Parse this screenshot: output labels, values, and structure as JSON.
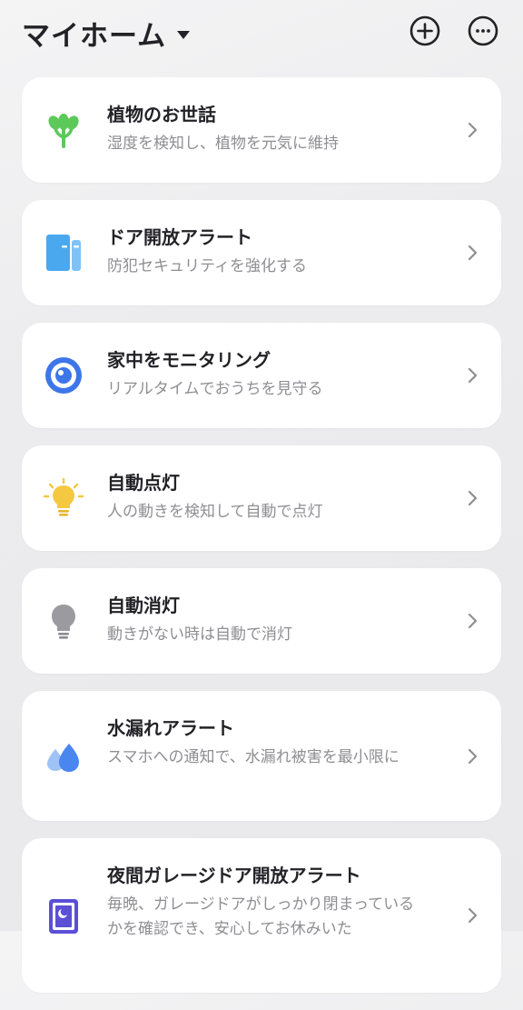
{
  "header": {
    "title": "マイホーム",
    "caret_icon": "caret-down-icon",
    "add_icon": "plus-circle-icon",
    "more_icon": "more-horizontal-icon"
  },
  "cards": [
    {
      "title": "植物のお世話",
      "description": "湿度を検知し、植物を元気に維持",
      "icon": "plant-icon",
      "icon_color": "#5cc95a"
    },
    {
      "title": "ドア開放アラート",
      "description": "防犯セキュリティを強化する",
      "icon": "door-sensor-icon",
      "icon_color": "#4aa8ef"
    },
    {
      "title": "家中をモニタリング",
      "description": "リアルタイムでおうちを見守る",
      "icon": "camera-eye-icon",
      "icon_color": "#3d76e8"
    },
    {
      "title": "自動点灯",
      "description": "人の動きを検知して自動で点灯",
      "icon": "lightbulb-on-icon",
      "icon_color": "#f5c842"
    },
    {
      "title": "自動消灯",
      "description": "動きがない時は自動で消灯",
      "icon": "lightbulb-off-icon",
      "icon_color": "#9a9aa0"
    },
    {
      "title": "水漏れアラート",
      "description": "スマホへの通知で、水漏れ被害を最小限に",
      "icon": "water-drops-icon",
      "icon_color": "#4a86f0"
    },
    {
      "title": "夜間ガレージドア開放アラート",
      "description": "毎晩、ガレージドアがしっかり閉まっているかを確認でき、安心してお休みいた",
      "icon": "garage-night-icon",
      "icon_color": "#5b4fd6"
    }
  ]
}
